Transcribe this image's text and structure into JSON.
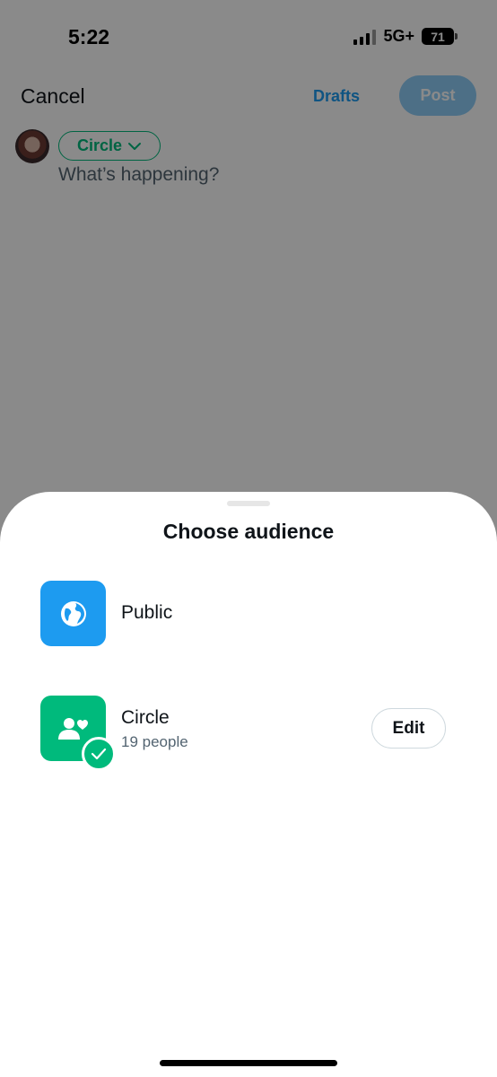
{
  "status_bar": {
    "time": "5:22",
    "network": "5G+",
    "battery": "71"
  },
  "compose": {
    "cancel_label": "Cancel",
    "drafts_label": "Drafts",
    "post_label": "Post",
    "audience_label": "Circle",
    "placeholder": "What’s happening?"
  },
  "sheet": {
    "title": "Choose audience",
    "options": [
      {
        "label": "Public",
        "icon": "globe-icon"
      },
      {
        "label": "Circle",
        "sublabel": "19 people",
        "icon": "circle-people-icon",
        "selected": true,
        "action_label": "Edit"
      }
    ]
  },
  "colors": {
    "accent_blue": "#1d9bf0",
    "circle_green": "#00ba7c",
    "post_disabled": "#8ecdf8"
  }
}
